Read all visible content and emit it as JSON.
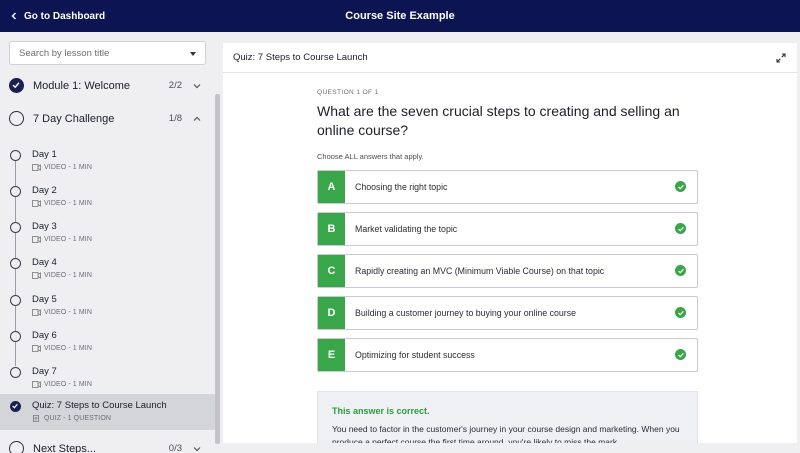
{
  "topbar": {
    "back_label": "Go to Dashboard",
    "site_title": "Course Site Example"
  },
  "sidebar": {
    "search_placeholder": "Search by lesson title",
    "modules": [
      {
        "title": "Module 1: Welcome",
        "count": "2/2",
        "complete": true,
        "expanded": false
      },
      {
        "title": "7 Day Challenge",
        "count": "1/8",
        "complete": false,
        "expanded": true
      },
      {
        "title": "Next Steps...",
        "count": "0/3",
        "complete": false,
        "expanded": false
      }
    ],
    "lessons": [
      {
        "title": "Day 1",
        "meta": "VIDEO - 1 MIN",
        "type_icon": "video-icon",
        "complete": false,
        "active": false
      },
      {
        "title": "Day 2",
        "meta": "VIDEO - 1 MIN",
        "type_icon": "video-icon",
        "complete": false,
        "active": false
      },
      {
        "title": "Day 3",
        "meta": "VIDEO - 1 MIN",
        "type_icon": "video-icon",
        "complete": false,
        "active": false
      },
      {
        "title": "Day 4",
        "meta": "VIDEO - 1 MIN",
        "type_icon": "video-icon",
        "complete": false,
        "active": false
      },
      {
        "title": "Day 5",
        "meta": "VIDEO - 1 MIN",
        "type_icon": "video-icon",
        "complete": false,
        "active": false
      },
      {
        "title": "Day 6",
        "meta": "VIDEO - 1 MIN",
        "type_icon": "video-icon",
        "complete": false,
        "active": false
      },
      {
        "title": "Day 7",
        "meta": "VIDEO - 1 MIN",
        "type_icon": "video-icon",
        "complete": false,
        "active": false
      },
      {
        "title": "Quiz: 7 Steps to Course Launch",
        "meta": "QUIZ - 1 QUESTION",
        "type_icon": "quiz-icon",
        "complete": true,
        "active": true
      }
    ]
  },
  "content": {
    "title": "Quiz: 7 Steps to Course Launch",
    "question_number": "QUESTION 1 OF 1",
    "question": "What are the seven crucial steps to creating and selling an online course?",
    "instructions": "Choose ALL answers that apply.",
    "answers": [
      {
        "letter": "A",
        "text": "Choosing the right topic",
        "correct": true
      },
      {
        "letter": "B",
        "text": "Market validating the topic",
        "correct": true
      },
      {
        "letter": "C",
        "text": "Rapidly creating an MVC (Minimum Viable Course) on that topic",
        "correct": true
      },
      {
        "letter": "D",
        "text": "Building a customer journey to buying your online course",
        "correct": true
      },
      {
        "letter": "E",
        "text": "Optimizing for student success",
        "correct": true
      }
    ],
    "feedback": {
      "title": "This answer is correct.",
      "text": "You need to factor in the customer's journey in your course design and marketing. When you produce a perfect course the first time around, you're likely to miss the mark."
    }
  },
  "colors": {
    "topbar": "#0c1452",
    "correct_green": "#3aa64a",
    "active_lesson_bg": "#d4d5d9"
  }
}
